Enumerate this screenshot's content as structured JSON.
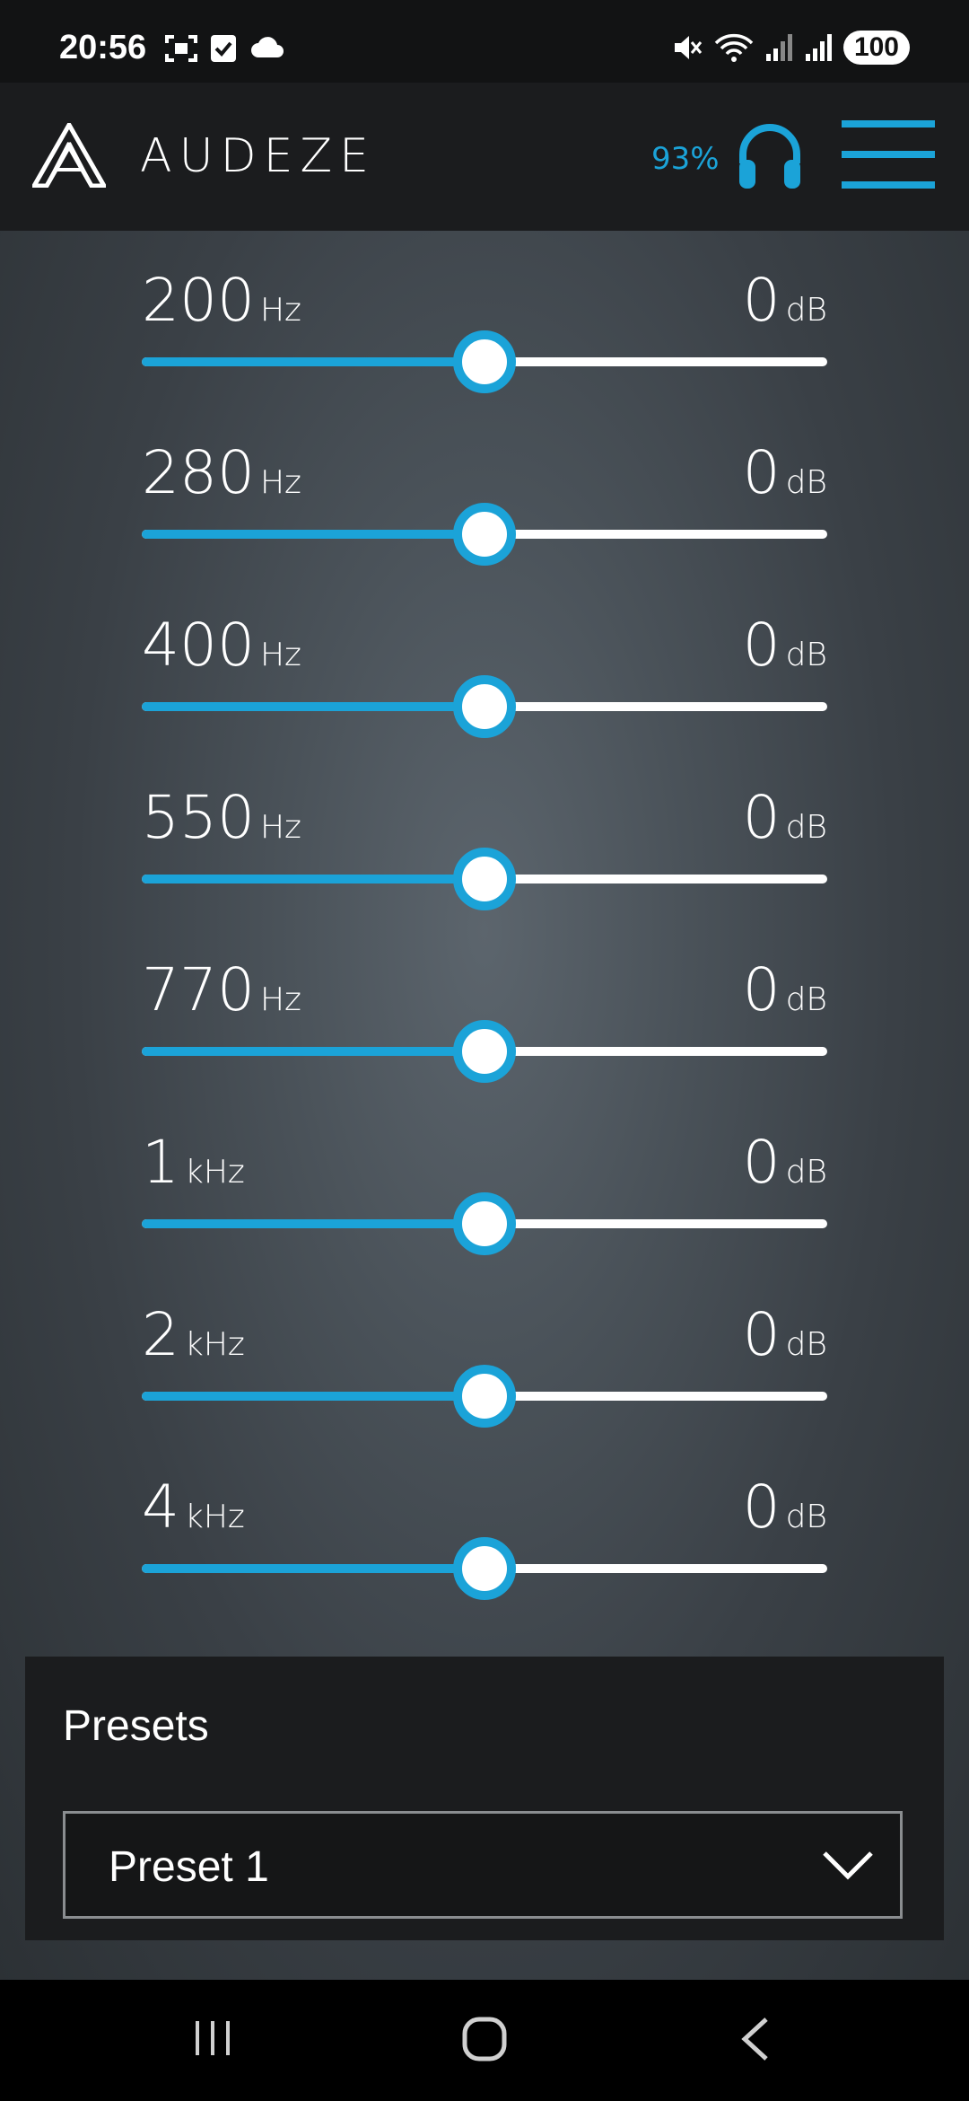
{
  "status_bar": {
    "time": "20:56",
    "battery": "100",
    "icons": [
      "screenshot-icon",
      "check-icon",
      "cloud-icon",
      "mute-icon",
      "wifi-icon",
      "signal-icon",
      "signal-icon"
    ]
  },
  "header": {
    "brand": "AUDEZE",
    "battery_percent": "93%",
    "accent_color": "#1ba3d8"
  },
  "eq": {
    "bands": [
      {
        "freq": "200",
        "freq_unit": "Hz",
        "gain": "0",
        "gain_unit": "dB",
        "level": 0.5
      },
      {
        "freq": "280",
        "freq_unit": "Hz",
        "gain": "0",
        "gain_unit": "dB",
        "level": 0.5
      },
      {
        "freq": "400",
        "freq_unit": "Hz",
        "gain": "0",
        "gain_unit": "dB",
        "level": 0.5
      },
      {
        "freq": "550",
        "freq_unit": "Hz",
        "gain": "0",
        "gain_unit": "dB",
        "level": 0.5
      },
      {
        "freq": "770",
        "freq_unit": "Hz",
        "gain": "0",
        "gain_unit": "dB",
        "level": 0.5
      },
      {
        "freq": "1",
        "freq_unit": "kHz",
        "gain": "0",
        "gain_unit": "dB",
        "level": 0.5
      },
      {
        "freq": "2",
        "freq_unit": "kHz",
        "gain": "0",
        "gain_unit": "dB",
        "level": 0.5
      },
      {
        "freq": "4",
        "freq_unit": "kHz",
        "gain": "0",
        "gain_unit": "dB",
        "level": 0.5
      }
    ]
  },
  "presets": {
    "title": "Presets",
    "selected": "Preset 1"
  },
  "nav": {
    "buttons": [
      "recents-icon",
      "home-icon",
      "back-icon"
    ]
  }
}
